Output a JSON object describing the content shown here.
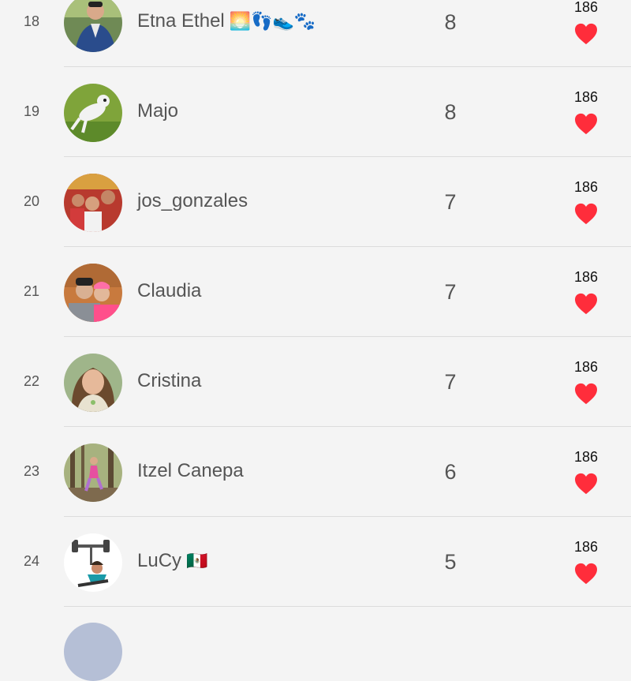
{
  "leaderboard": {
    "rows": [
      {
        "rank": "18",
        "name": "Etna Ethel",
        "emoji": "🌅👣👟🐾",
        "score": "8",
        "likes": "186"
      },
      {
        "rank": "19",
        "name": "Majo",
        "emoji": "",
        "score": "8",
        "likes": "186"
      },
      {
        "rank": "20",
        "name": "jos_gonzales",
        "emoji": "",
        "score": "7",
        "likes": "186"
      },
      {
        "rank": "21",
        "name": "Claudia",
        "emoji": "",
        "score": "7",
        "likes": "186"
      },
      {
        "rank": "22",
        "name": "Cristina",
        "emoji": "",
        "score": "7",
        "likes": "186"
      },
      {
        "rank": "23",
        "name": "Itzel Canepa",
        "emoji": "",
        "score": "6",
        "likes": "186"
      },
      {
        "rank": "24",
        "name": "LuCy",
        "emoji": "🇲🇽",
        "score": "5",
        "likes": "186"
      }
    ]
  },
  "colors": {
    "background": "#f4f4f4",
    "heart": "#ff2d3b",
    "divider": "#dcdcdc",
    "text": "#555555"
  },
  "icons": {
    "like": "heart-icon"
  }
}
